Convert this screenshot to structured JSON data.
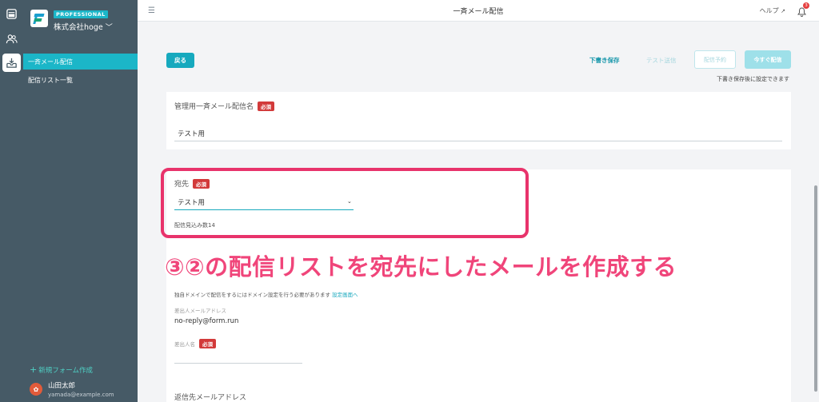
{
  "rail": {
    "items": [
      {
        "icon": "forms-icon",
        "active": false
      },
      {
        "icon": "users-icon",
        "active": false
      },
      {
        "icon": "inbox-icon",
        "active": true
      }
    ]
  },
  "brand": {
    "plan": "PROFESSIONAL",
    "company": "株式会社hoge"
  },
  "sidebar": {
    "items": [
      {
        "label": "一斉メール配信",
        "active": true
      },
      {
        "label": "配信リスト一覧",
        "active": false
      }
    ],
    "new_form": "新規フォーム作成",
    "user_name": "山田太郎",
    "user_email": "yamada@example.com"
  },
  "header": {
    "title": "一斉メール配信",
    "help": "ヘルプ",
    "notification_count": "3"
  },
  "actions": {
    "back": "戻る",
    "save_draft": "下書き保存",
    "test_send": "テスト送信",
    "schedule": "配信予約",
    "send_now": "今すぐ配信",
    "draft_note": "下書き保存後に設定できます"
  },
  "form": {
    "admin_name_label": "管理用一斉メール配信名",
    "required": "必須",
    "admin_name_value": "テスト用",
    "recipient_label": "宛先",
    "recipient_value": "テスト用",
    "estimated_count": "配信見込み数14",
    "domain_note": "独自ドメインで配信をするにはドメイン設定を行う必要があります",
    "domain_link": "設定画面へ",
    "sender_address_label": "差出人メールアドレス",
    "sender_address_value": "no-reply@form.run",
    "sender_name_label": "差出人名",
    "reply_to_label": "返信先メールアドレス"
  },
  "annotation": {
    "text": "③②の配信リストを宛先にしたメールを作成する"
  },
  "colors": {
    "sidebar_bg": "#465a66",
    "accent": "#1bb6c8",
    "required": "#d23a3a",
    "annotation": "#e8336b"
  }
}
